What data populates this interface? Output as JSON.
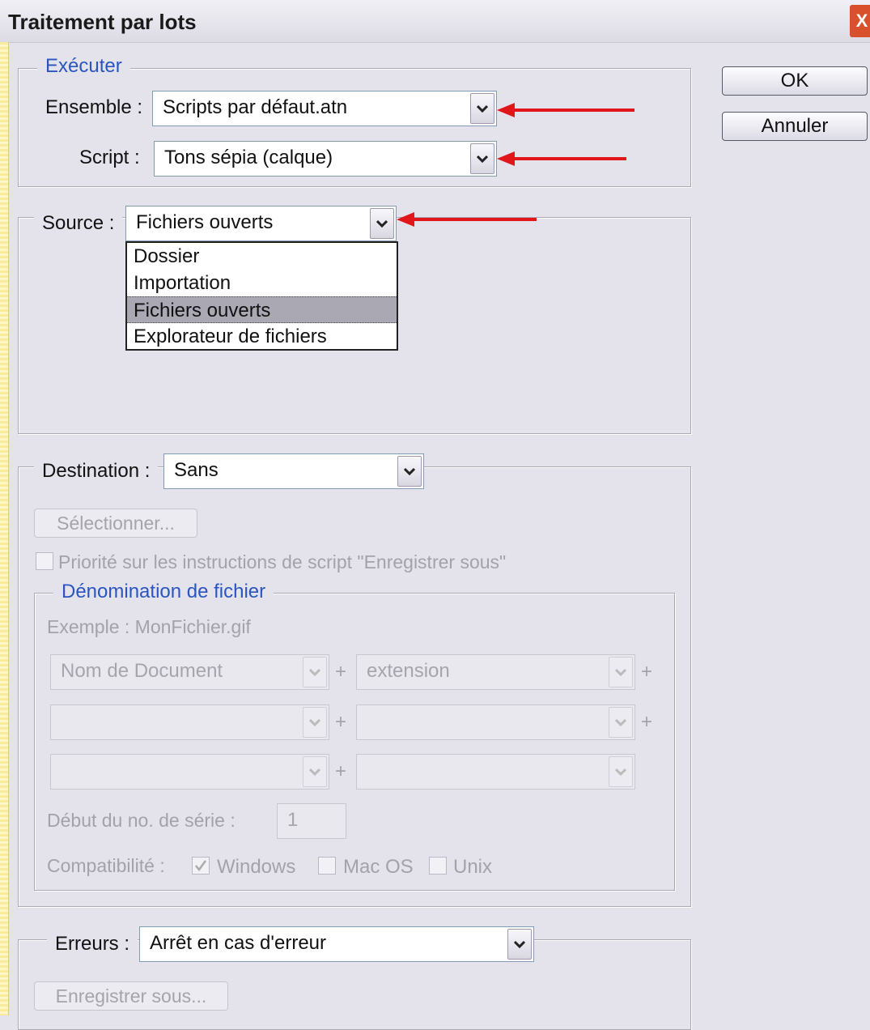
{
  "window": {
    "title": "Traitement par lots",
    "close_glyph": "X"
  },
  "execute": {
    "legend": "Exécuter",
    "set_label": "Ensemble :",
    "set_value": "Scripts par défaut.atn",
    "script_label": "Script :",
    "script_value": "Tons sépia (calque)"
  },
  "buttons": {
    "ok": "OK",
    "cancel": "Annuler"
  },
  "source": {
    "label": "Source :",
    "value": "Fichiers ouverts",
    "options": [
      "Dossier",
      "Importation",
      "Fichiers ouverts",
      "Explorateur de fichiers"
    ],
    "selected_index": 2
  },
  "destination": {
    "label": "Destination :",
    "value": "Sans",
    "select_button": "Sélectionner...",
    "override_label": "Priorité sur les instructions de script \"Enregistrer sous\""
  },
  "naming": {
    "legend": "Dénomination de fichier",
    "example": "Exemple : MonFichier.gif",
    "field1": "Nom de Document",
    "field2": "extension",
    "plus": "+",
    "serial_label": "Début du no. de série :",
    "serial_value": "1",
    "compat_label": "Compatibilité :",
    "windows": "Windows",
    "macos": "Mac OS",
    "unix": "Unix"
  },
  "errors": {
    "label": "Erreurs :",
    "value": "Arrêt en cas d'erreur",
    "save_as_button": "Enregistrer sous..."
  },
  "colors": {
    "accent_arrow": "#e0161b",
    "legend_blue": "#2a55c0"
  }
}
